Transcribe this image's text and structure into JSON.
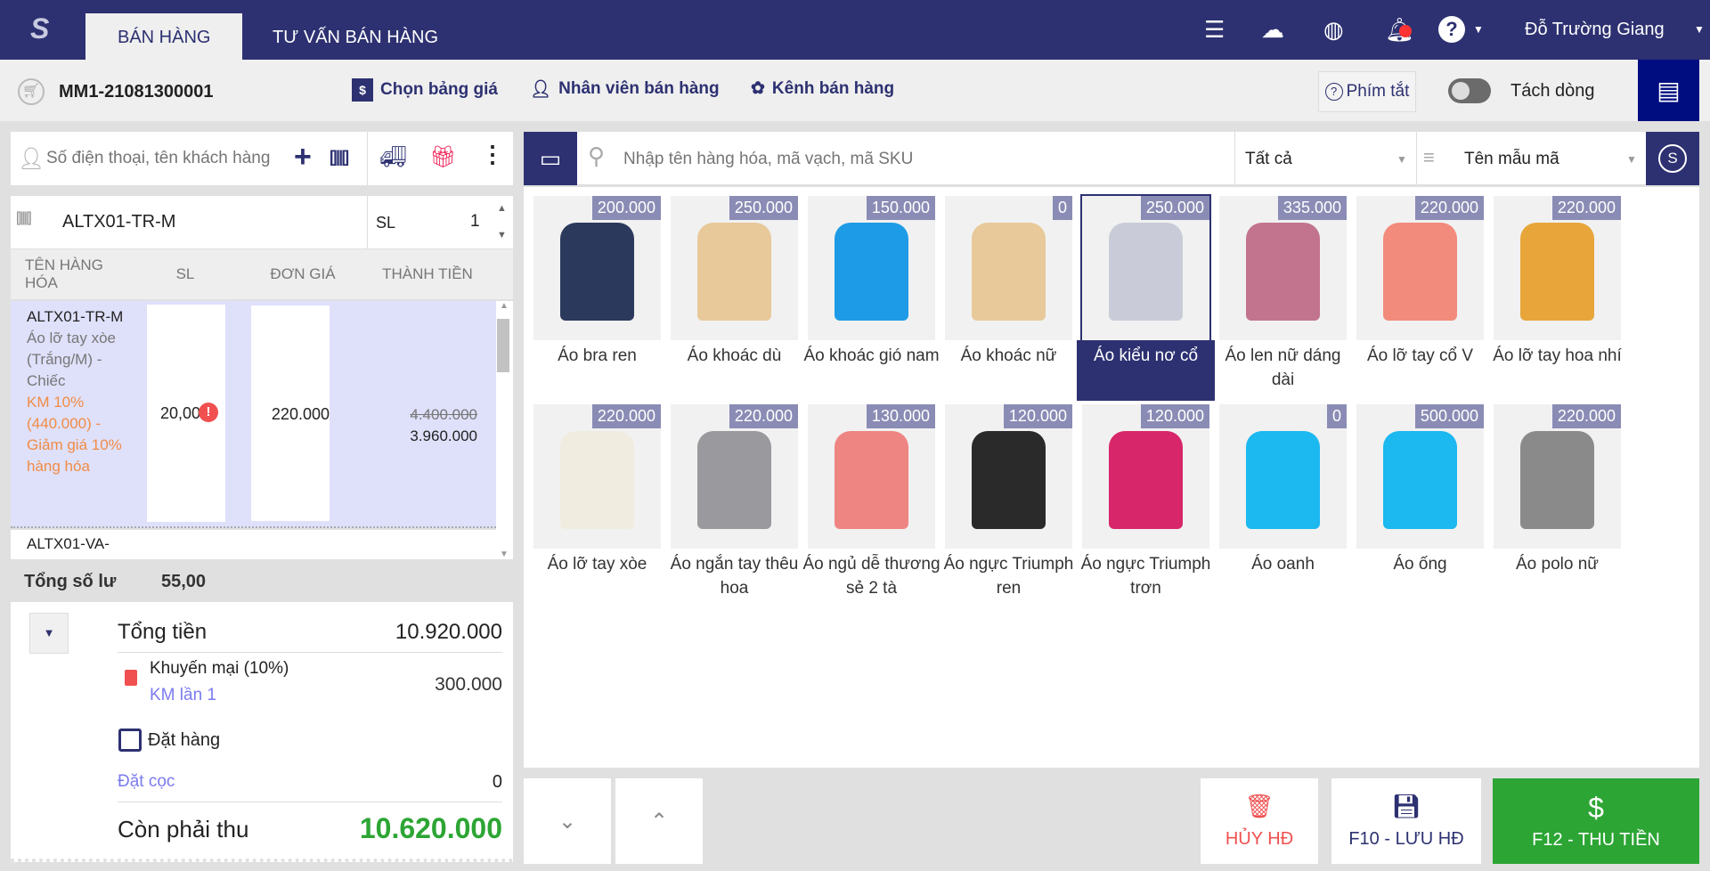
{
  "header": {
    "tabs": [
      "BÁN HÀNG",
      "TƯ VẤN BÁN HÀNG"
    ],
    "user": "Đỗ Trường Giang"
  },
  "toolbar": {
    "invoice_code": "MM1-21081300001",
    "price_list": "Chọn bảng giá",
    "staff": "Nhân viên bán hàng",
    "channel": "Kênh bán hàng",
    "shortcuts": "Phím tắt",
    "split_lines": "Tách dòng",
    "split_on": false
  },
  "customer": {
    "placeholder": "Số điện thoại, tên khách hàng"
  },
  "product_input": {
    "value": "ALTX01-TR-M",
    "qty_label": "SL",
    "qty": "1"
  },
  "cart": {
    "columns": [
      "TÊN HÀNG HÓA",
      "SL",
      "ĐƠN GIÁ",
      "THÀNH TIỀN"
    ],
    "rows": [
      {
        "code": "ALTX01-TR-M",
        "desc": "Áo lỡ tay xòe (Trắng/M) - Chiếc",
        "promo": "KM 10% (440.000) - Giảm giá 10% hàng hóa",
        "qty": "20,00",
        "price": "220.000",
        "old_total": "4.400.000",
        "total": "3.960.000"
      },
      {
        "code": "ALTX01-VA-"
      }
    ]
  },
  "totals": {
    "qty_label": "Tổng số lư",
    "qty": "55,00",
    "sum_label": "Tổng tiền",
    "sum": "10.920.000",
    "promo_label": "Khuyến mại (10%)",
    "promo_sub": "KM lần 1",
    "promo_value": "300.000",
    "order_label": "Đặt hàng",
    "deposit_label": "Đặt cọc",
    "deposit": "0",
    "due_label": "Còn phải thu",
    "due": "10.620.000"
  },
  "search": {
    "placeholder": "Nhập tên hàng hóa, mã vạch, mã SKU",
    "category": "Tất cả",
    "sort": "Tên mẫu mã"
  },
  "products": [
    {
      "name": "Áo bra ren",
      "price": "200.000",
      "color": "#2b3a5c"
    },
    {
      "name": "Áo khoác dù",
      "price": "250.000",
      "color": "#e8c99a"
    },
    {
      "name": "Áo khoác gió nam",
      "price": "150.000",
      "color": "#1e9be6"
    },
    {
      "name": "Áo khoác nữ",
      "price": "0",
      "color": "#e8c99a"
    },
    {
      "name": "Áo kiểu nơ cổ",
      "price": "250.000",
      "color": "#c9ccd8",
      "selected": true
    },
    {
      "name": "Áo len nữ dáng dài",
      "price": "335.000",
      "color": "#c2748f"
    },
    {
      "name": "Áo lỡ tay cổ V",
      "price": "220.000",
      "color": "#f28b7c"
    },
    {
      "name": "Áo lỡ tay hoa nhí",
      "price": "220.000",
      "color": "#e8a63a"
    },
    {
      "name": "Áo lỡ tay xòe",
      "price": "220.000",
      "color": "#f1ece0"
    },
    {
      "name": "Áo ngắn tay thêu hoa",
      "price": "220.000",
      "color": "#9a9a9e"
    },
    {
      "name": "Áo ngủ dễ thương sẻ 2 tà",
      "price": "130.000",
      "color": "#ee8583"
    },
    {
      "name": "Áo ngực Triumph ren",
      "price": "120.000",
      "color": "#2a2a2a"
    },
    {
      "name": "Áo ngực Triumph trơn",
      "price": "120.000",
      "color": "#d8266a"
    },
    {
      "name": "Áo oanh",
      "price": "0",
      "color": "#1cb8f0"
    },
    {
      "name": "Áo ống",
      "price": "500.000",
      "color": "#1cb8f0"
    },
    {
      "name": "Áo polo nữ",
      "price": "220.000",
      "color": "#8a8a8a"
    }
  ],
  "actions": {
    "cancel": "HỦY HĐ",
    "save": "F10 - LƯU HĐ",
    "pay": "F12 - THU TIỀN"
  },
  "colors": {
    "primary": "#2d3171",
    "green": "#2ca534",
    "red": "#f05050",
    "orange": "#f08c46"
  }
}
